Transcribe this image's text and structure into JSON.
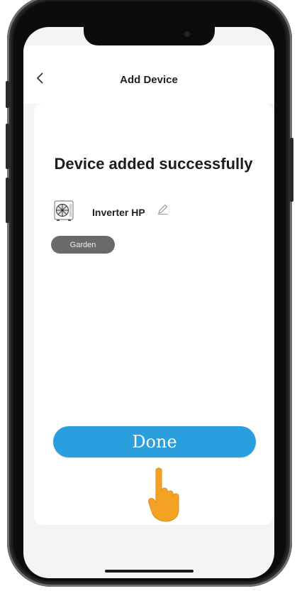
{
  "header": {
    "title": "Add Device"
  },
  "card": {
    "success_text": "Device added successfully",
    "device_name": "Inverter HP",
    "room_chip": "Garden",
    "done_label": "Done"
  },
  "colors": {
    "accent": "#2b9fde",
    "chip_bg": "#6a6a6a",
    "hand": "#f4a223"
  }
}
